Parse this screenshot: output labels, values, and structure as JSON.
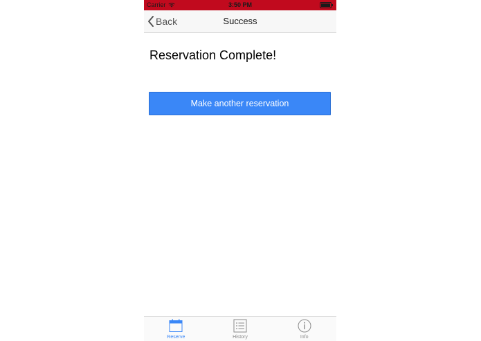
{
  "status_bar": {
    "carrier": "Carrier",
    "time": "3:50 PM",
    "icons": [
      "wifi-icon",
      "battery-icon"
    ]
  },
  "nav": {
    "back_label": "Back",
    "title": "Success"
  },
  "main": {
    "heading": "Reservation Complete!",
    "primary_button_label": "Make another reservation"
  },
  "tabs": [
    {
      "label": "Reserve",
      "icon": "calendar-icon",
      "active": true
    },
    {
      "label": "History",
      "icon": "list-icon",
      "active": false
    },
    {
      "label": "Info",
      "icon": "info-icon",
      "active": false
    }
  ],
  "colors": {
    "status_bar": "#c10a1e",
    "accent": "#3a87f7",
    "nav_background": "#f7f7f7",
    "inactive_tab": "#8a8a8a"
  }
}
